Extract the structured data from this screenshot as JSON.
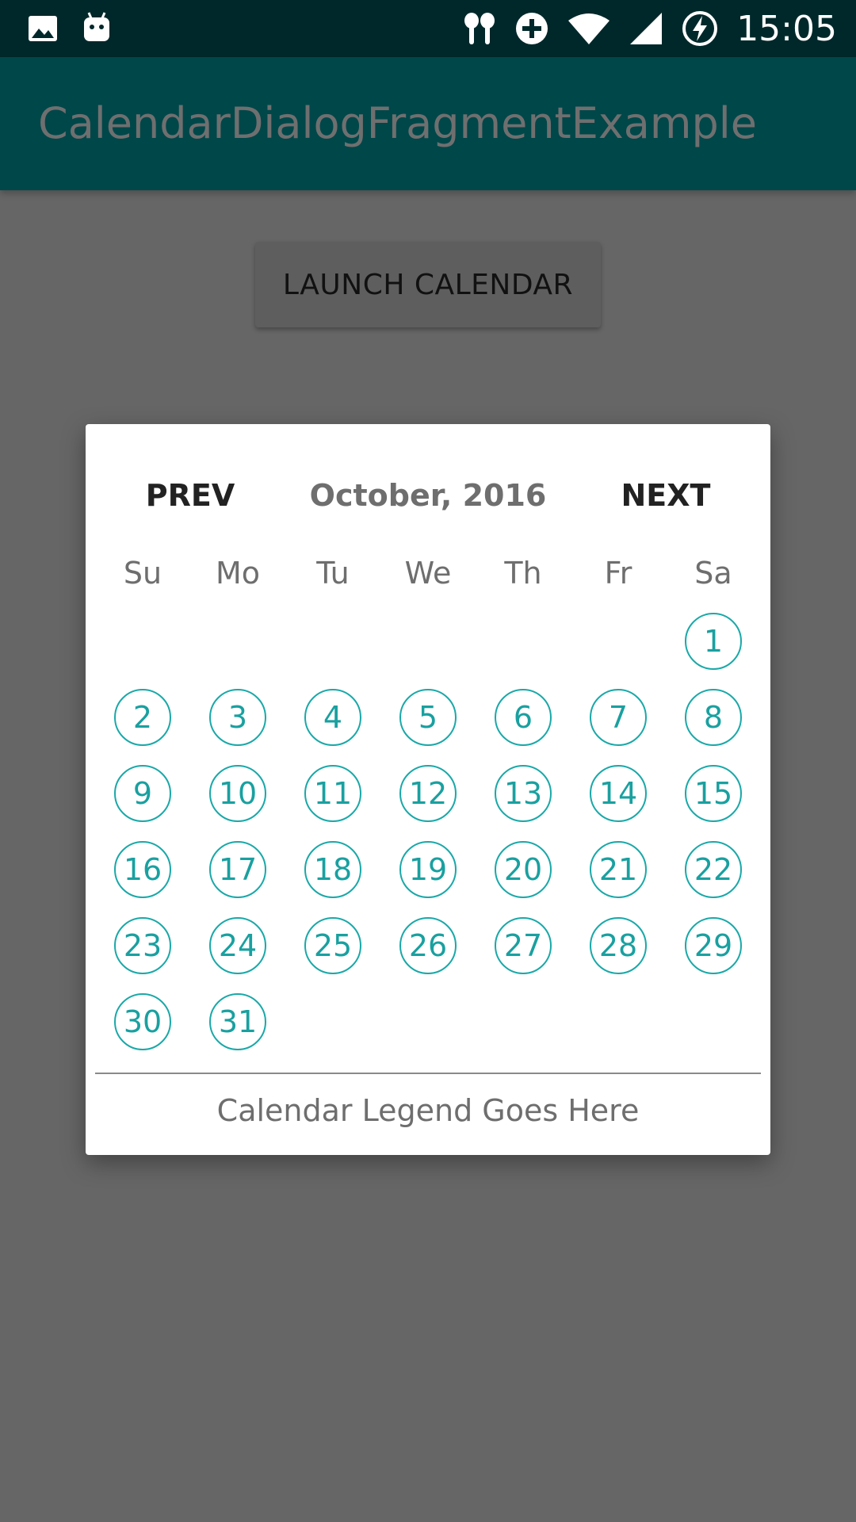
{
  "status_bar": {
    "time": "15:05",
    "icons": [
      "image-icon",
      "android-icon",
      "earbuds-icon",
      "data-saver-icon",
      "wifi-icon",
      "signal-icon",
      "battery-charging-icon"
    ]
  },
  "app_bar": {
    "title": "CalendarDialogFragmentExample"
  },
  "main": {
    "launch_button_label": "LAUNCH CALENDAR"
  },
  "dialog": {
    "prev_label": "PREV",
    "month_title": "October, 2016",
    "next_label": "NEXT",
    "weekdays": [
      "Su",
      "Mo",
      "Tu",
      "We",
      "Th",
      "Fr",
      "Sa"
    ],
    "first_day_column": 6,
    "days": [
      "1",
      "2",
      "3",
      "4",
      "5",
      "6",
      "7",
      "8",
      "9",
      "10",
      "11",
      "12",
      "13",
      "14",
      "15",
      "16",
      "17",
      "18",
      "19",
      "20",
      "21",
      "22",
      "23",
      "24",
      "25",
      "26",
      "27",
      "28",
      "29",
      "30",
      "31"
    ],
    "legend": "Calendar Legend Goes Here"
  },
  "colors": {
    "status_bar_bg": "#00282a",
    "app_bar_bg": "#00474a",
    "scrim_bg": "#666666",
    "accent": "#1aa8a8"
  }
}
